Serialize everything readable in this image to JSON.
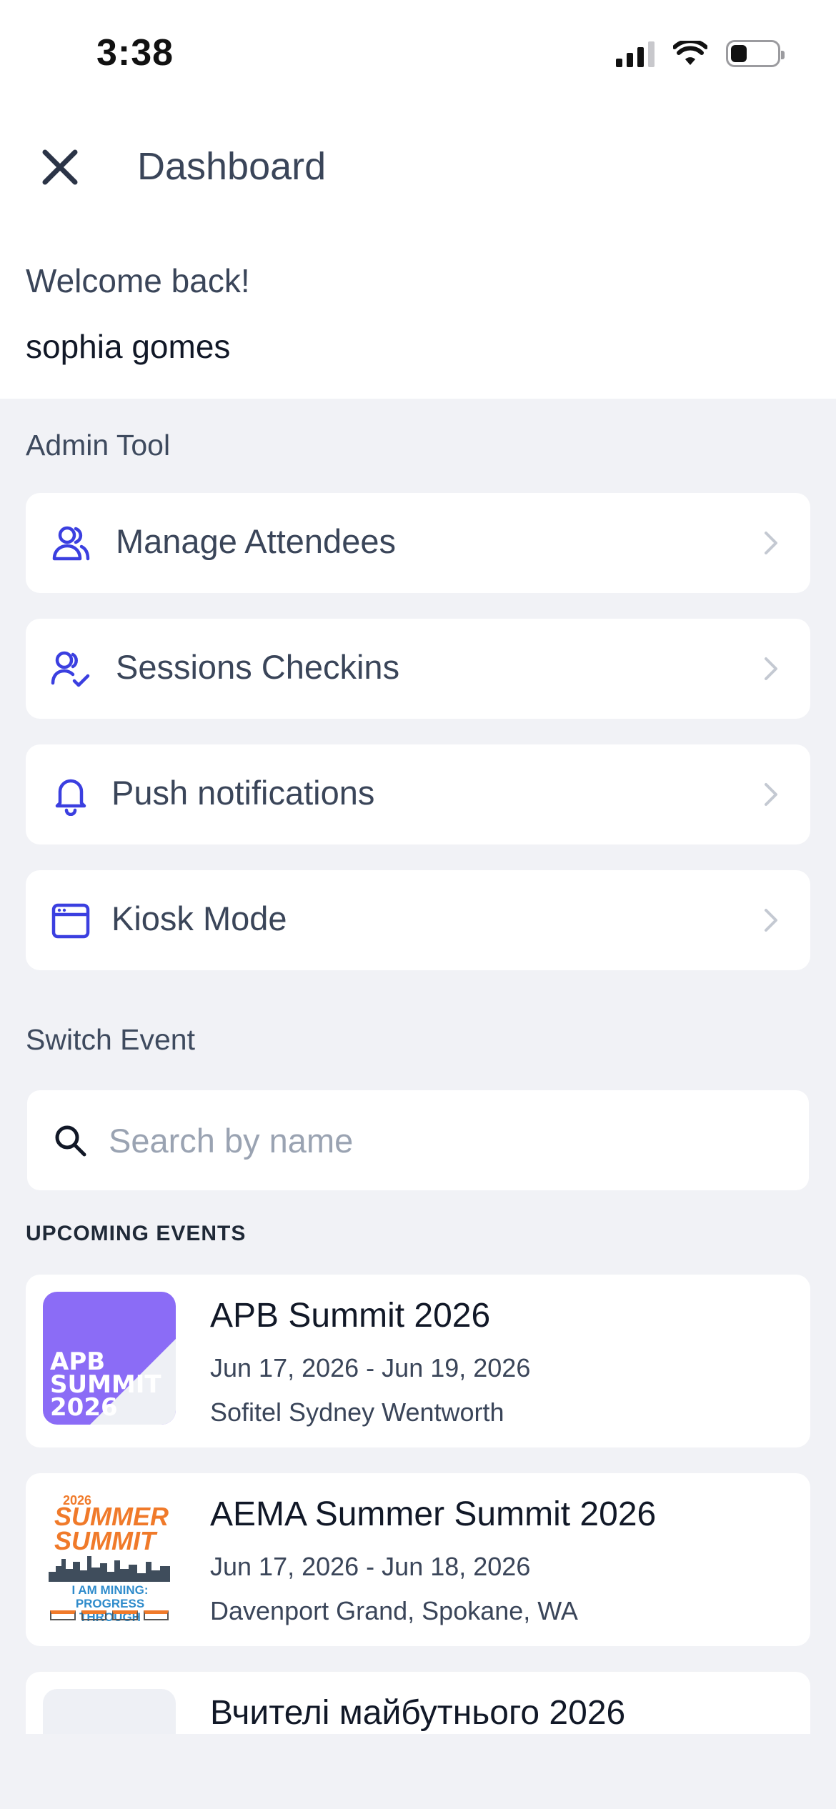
{
  "status_bar": {
    "time": "3:38",
    "signal_bars_active": 3,
    "signal_bars_total": 4,
    "battery_level": 0.35
  },
  "header": {
    "title": "Dashboard",
    "close_icon": "close-icon"
  },
  "greeting": {
    "welcome": "Welcome back!",
    "user_name": "sophia gomes"
  },
  "admin_tool": {
    "label": "Admin Tool",
    "items": [
      {
        "label": "Manage Attendees",
        "icon": "users-icon"
      },
      {
        "label": "Sessions Checkins",
        "icon": "user-check-icon"
      },
      {
        "label": "Push notifications",
        "icon": "bell-icon"
      },
      {
        "label": "Kiosk Mode",
        "icon": "browser-window-icon"
      }
    ]
  },
  "switch_event": {
    "label": "Switch Event",
    "search_placeholder": "Search by name",
    "search_value": "",
    "upcoming_label": "UPCOMING EVENTS",
    "events": [
      {
        "name": "APB Summit 2026",
        "dates": "Jun 17, 2026 - Jun 19, 2026",
        "venue": "Sofitel Sydney Wentworth",
        "logo_text": [
          "APB",
          "SUMMIT",
          "2026"
        ]
      },
      {
        "name": "AEMA Summer Summit 2026",
        "dates": "Jun 17, 2026 - Jun 18, 2026",
        "venue": "Davenport Grand, Spokane, WA",
        "logo_text": [
          "2026",
          "SUMMER",
          "SUMMIT",
          "I AM MINING: PROGRESS",
          "THROUGH PARTNERSHIP"
        ]
      },
      {
        "name": "Вчителі майбутнього 2026",
        "dates": "",
        "venue": ""
      }
    ]
  },
  "colors": {
    "accent": "#3b3fe0",
    "page_bg": "#f1f2f6",
    "card_bg": "#ffffff",
    "text_primary": "#3a4559",
    "apb_purple": "#8b6cf6"
  }
}
